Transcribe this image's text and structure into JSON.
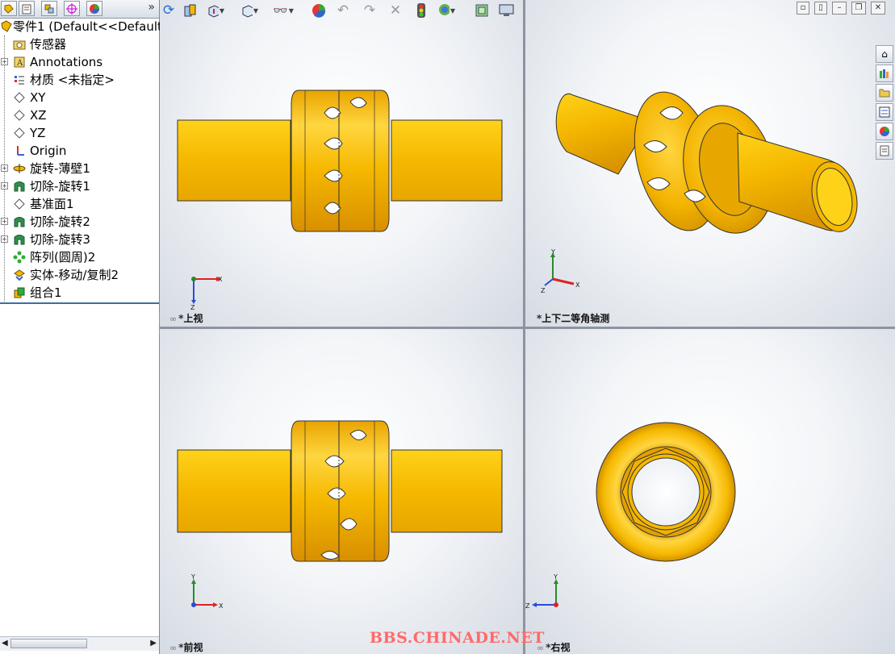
{
  "tree": {
    "tabs": [
      "feature-manager",
      "property-manager",
      "configuration-manager",
      "dimxpert-manager",
      "display-manager"
    ],
    "more": "»",
    "root": "零件1  (Default<<Default",
    "nodes": [
      {
        "label": "传感器",
        "icon": "sensor-folder-icon",
        "expand": false
      },
      {
        "label": "Annotations",
        "icon": "annotations-icon",
        "expand": true
      },
      {
        "label": "材质 <未指定>",
        "icon": "material-icon",
        "expand": false
      },
      {
        "label": "XY",
        "icon": "plane-icon",
        "expand": false
      },
      {
        "label": "XZ",
        "icon": "plane-icon",
        "expand": false
      },
      {
        "label": "YZ",
        "icon": "plane-icon",
        "expand": false
      },
      {
        "label": "Origin",
        "icon": "origin-icon",
        "expand": false
      },
      {
        "label": "旋转-薄壁1",
        "icon": "revolve-thin-icon",
        "expand": true
      },
      {
        "label": "切除-旋转1",
        "icon": "cut-revolve-icon",
        "expand": true
      },
      {
        "label": "基准面1",
        "icon": "plane-icon",
        "expand": false
      },
      {
        "label": "切除-旋转2",
        "icon": "cut-revolve-icon",
        "expand": true
      },
      {
        "label": "切除-旋转3",
        "icon": "cut-revolve-icon",
        "expand": true
      },
      {
        "label": "阵列(圆周)2",
        "icon": "circular-pattern-icon",
        "expand": false
      },
      {
        "label": "实体-移动/复制2",
        "icon": "move-copy-body-icon",
        "expand": false
      },
      {
        "label": "组合1",
        "icon": "combine-icon",
        "expand": false
      }
    ]
  },
  "viewports": {
    "top": {
      "label": "*上视"
    },
    "iso": {
      "label": "*上下二等角轴测"
    },
    "front": {
      "label": "*前视"
    },
    "right": {
      "label": "*右视"
    }
  },
  "axes": {
    "x": "X",
    "y": "Y",
    "z": "Z"
  },
  "toolbar_icons": [
    "rotate-icon",
    "section-view-icon",
    "view-orientation-icon",
    "display-style-icon",
    "hide-show-icon",
    "appearance-icon",
    "undo-icon",
    "redo-icon",
    "close-x-icon",
    "traffic-light-icon",
    "scene-icon",
    "view-settings-icon",
    "monitor-icon"
  ],
  "task_pane": [
    "home-icon",
    "design-library-icon",
    "file-explorer-icon",
    "view-palette-icon",
    "appearances-icon",
    "custom-properties-icon"
  ],
  "watermark": "BBS.CHINADE.NET",
  "colors": {
    "part": "#f5b800",
    "part_dark": "#c88a00",
    "tree_sep": "#3a6ea5"
  }
}
